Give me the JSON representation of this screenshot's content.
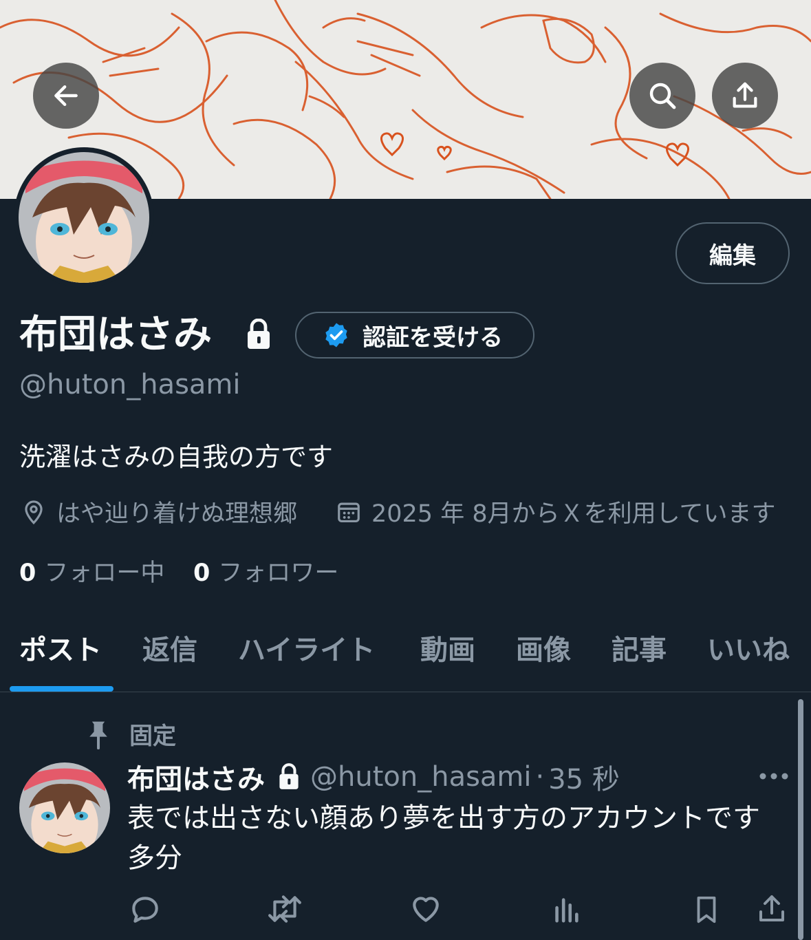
{
  "profile": {
    "display_name": "布団はさみ",
    "handle": "@huton_hasami",
    "bio": "洗濯はさみの自我の方です",
    "location": "はや辿り着けぬ理想郷",
    "joined": "2025 年 8月からＸを利用しています",
    "following_count": "0",
    "following_label": "フォロー中",
    "followers_count": "0",
    "followers_label": "フォロワー"
  },
  "buttons": {
    "edit": "編集",
    "verify": "認証を受ける"
  },
  "tabs": [
    {
      "label": "ポスト",
      "active": true
    },
    {
      "label": "返信"
    },
    {
      "label": "ハイライト"
    },
    {
      "label": "動画"
    },
    {
      "label": "画像"
    },
    {
      "label": "記事"
    },
    {
      "label": "いいね"
    }
  ],
  "pinned_post": {
    "pinned_label": "固定",
    "author": "布団はさみ",
    "handle": "@huton_hasami",
    "separator": "·",
    "time": "35 秒",
    "text": "表では出さない顔あり夢を出す方のアカウントです多分"
  },
  "colors": {
    "background": "#15202b",
    "accent": "#1d9bf0",
    "muted_text": "#8b98a5",
    "border": "#536471",
    "banner_ink": "#d8521e"
  },
  "icons": {
    "back": "arrow-left-icon",
    "search": "search-icon",
    "share": "share-icon",
    "lock": "lock-icon",
    "verified": "verified-badge-icon",
    "location": "location-pin-icon",
    "calendar": "calendar-icon",
    "pin": "pin-icon",
    "more": "more-dots-icon",
    "reply": "reply-icon",
    "repost": "repost-icon",
    "like": "heart-icon",
    "views": "views-icon",
    "bookmark": "bookmark-icon"
  }
}
